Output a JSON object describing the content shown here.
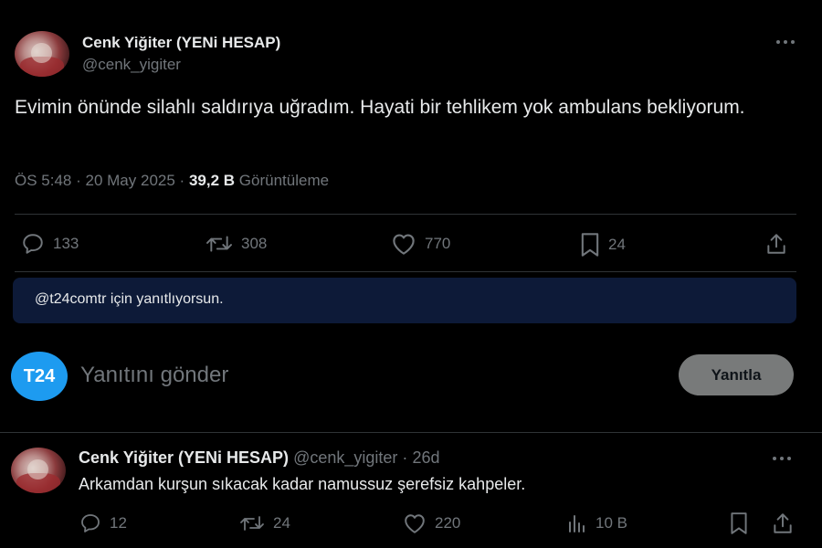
{
  "main_tweet": {
    "author_name": "Cenk Yiğiter (YENi HESAP)",
    "handle": "@cenk_yigiter",
    "text": "Evimin önünde silahlı saldırıya uğradım. Hayati bir tehlikem yok ambulans bekliyorum.",
    "time": "ÖS 5:48",
    "separator": "·",
    "date": "20 May 2025",
    "views_count": "39,2 B",
    "views_label": "Görüntüleme",
    "actions": {
      "replies": "133",
      "reposts": "308",
      "likes": "770",
      "bookmarks": "24"
    }
  },
  "reply_banner": {
    "text": "@t24comtr için yanıtlıyorsun."
  },
  "composer": {
    "avatar_text": "T24",
    "placeholder": "Yanıtını gönder",
    "button_label": "Yanıtla"
  },
  "reply_tweet": {
    "author_name": "Cenk Yiğiter (YENi HESAP)",
    "handle": "@cenk_yigiter",
    "separator": "·",
    "age": "26d",
    "text": "Arkamdan kurşun sıkacak kadar namussuz şerefsiz kahpeler.",
    "actions": {
      "replies": "12",
      "reposts": "24",
      "likes": "220",
      "views": "10 B"
    }
  },
  "colors": {
    "background": "#000000",
    "text": "#e7e9ea",
    "muted": "#71767b",
    "accent": "#1d9bf0",
    "banner": "#0d1a38",
    "button": "#787a7a"
  }
}
